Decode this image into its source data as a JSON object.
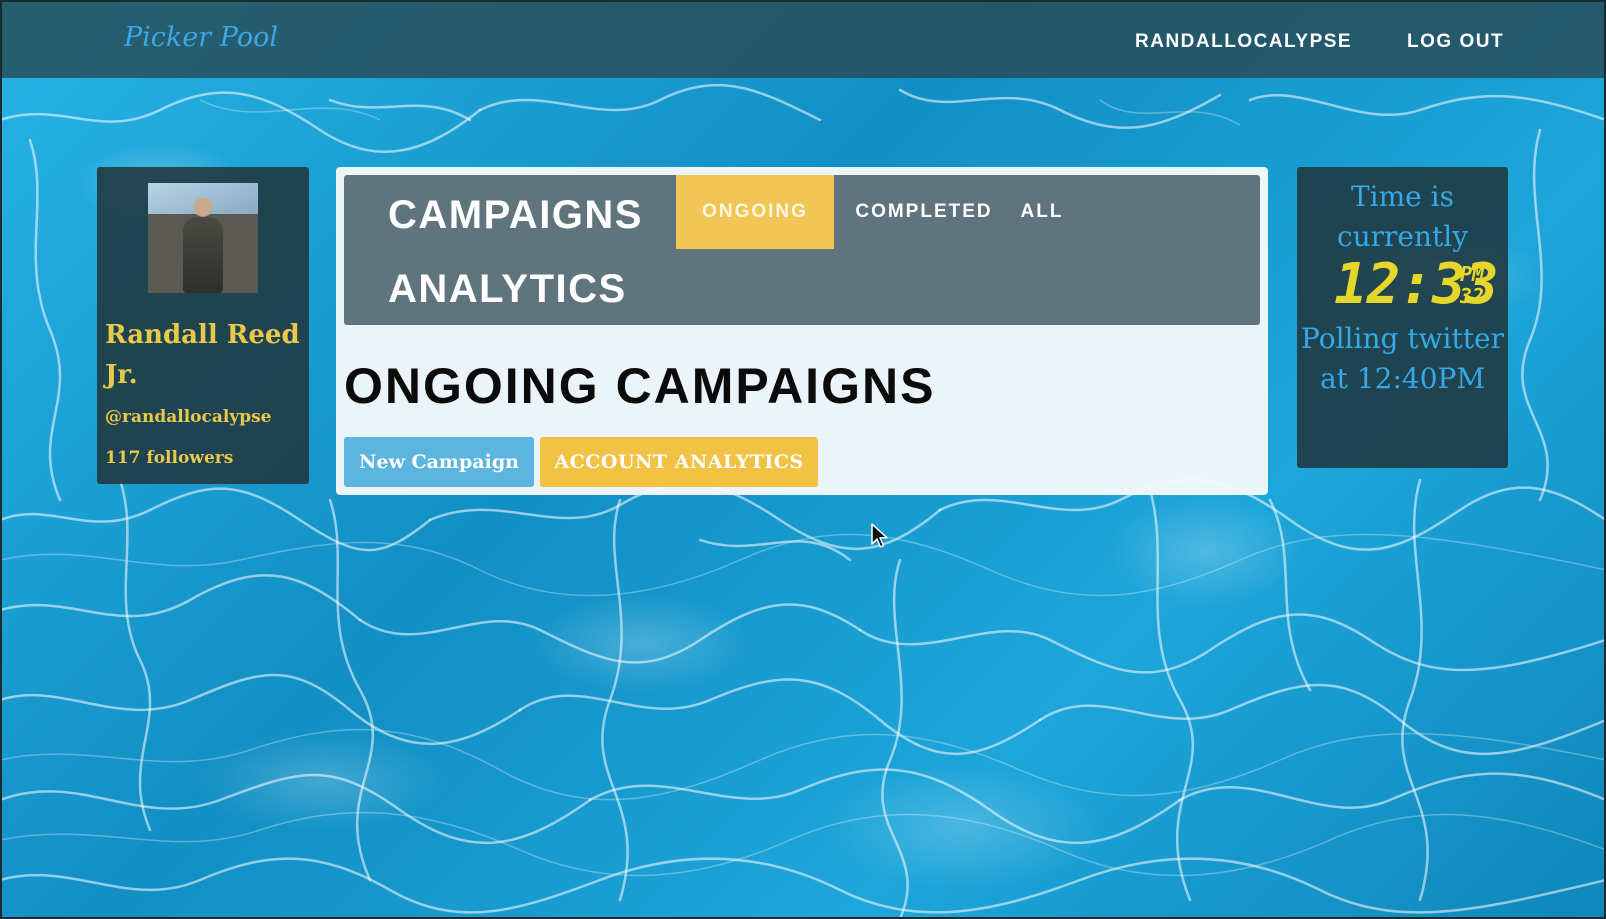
{
  "navbar": {
    "brand": "Picker Pool",
    "user_link": "RANDALLOCALYPSE",
    "logout_link": "LOG OUT"
  },
  "profile": {
    "name": "Randall Reed Jr.",
    "handle": "@randallocalypse",
    "followers": "117 followers"
  },
  "tabs": {
    "heading_campaigns": "CAMPAIGNS",
    "heading_analytics": "ANALYTICS",
    "items": [
      {
        "label": "ONGOING",
        "active": true
      },
      {
        "label": "COMPLETED",
        "active": false
      },
      {
        "label": "ALL",
        "active": false
      }
    ]
  },
  "main": {
    "section_title": "ONGOING CAMPAIGNS",
    "new_campaign_label": "New Campaign",
    "account_analytics_label": "ACCOUNT ANALYTICS"
  },
  "clock": {
    "label": "Time is currently",
    "time": "12:33",
    "ampm": "PM",
    "seconds": "32",
    "polling": "Polling twitter at 12:40PM"
  },
  "colors": {
    "accent_yellow": "#f2c557",
    "accent_blue": "#5bb5df",
    "text_gold": "#e8c94a",
    "clock_digits": "#e6d52a",
    "clock_text": "#35a8e6"
  },
  "icons": {
    "cursor": "mouse-pointer-icon"
  }
}
